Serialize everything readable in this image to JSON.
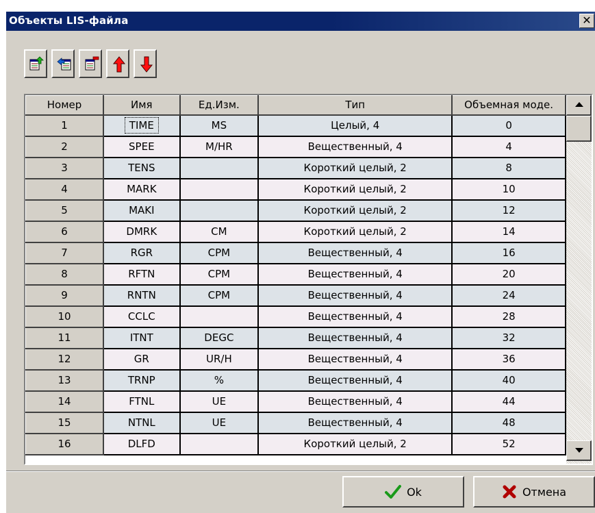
{
  "window": {
    "title": "Объекты LIS-файла",
    "close_glyph": "✕"
  },
  "toolbar": {
    "buttons": [
      {
        "name": "add-object-icon"
      },
      {
        "name": "copy-object-icon"
      },
      {
        "name": "delete-object-icon"
      },
      {
        "name": "move-up-arrow-icon"
      },
      {
        "name": "move-down-arrow-icon"
      }
    ]
  },
  "table": {
    "columns": [
      "Номер",
      "Имя",
      "Ед.Изм.",
      "Тип",
      "Объемная моде."
    ],
    "rows": [
      [
        "1",
        "TIME",
        "MS",
        "Целый, 4",
        "0"
      ],
      [
        "2",
        "SPEE",
        "M/HR",
        "Вещественный, 4",
        "4"
      ],
      [
        "3",
        "TENS",
        "",
        "Короткий целый, 2",
        "8"
      ],
      [
        "4",
        "MARK",
        "",
        "Короткий целый, 2",
        "10"
      ],
      [
        "5",
        "MAKI",
        "",
        "Короткий целый, 2",
        "12"
      ],
      [
        "6",
        "DMRK",
        "CM",
        "Короткий целый, 2",
        "14"
      ],
      [
        "7",
        "RGR",
        "CPM",
        "Вещественный, 4",
        "16"
      ],
      [
        "8",
        "RFTN",
        "CPM",
        "Вещественный, 4",
        "20"
      ],
      [
        "9",
        "RNTN",
        "CPM",
        "Вещественный, 4",
        "24"
      ],
      [
        "10",
        "CCLC",
        "",
        "Вещественный, 4",
        "28"
      ],
      [
        "11",
        "ITNT",
        "DEGC",
        "Вещественный, 4",
        "32"
      ],
      [
        "12",
        "GR",
        "UR/H",
        "Вещественный, 4",
        "36"
      ],
      [
        "13",
        "TRNP",
        "%",
        "Вещественный, 4",
        "40"
      ],
      [
        "14",
        "FTNL",
        "UE",
        "Вещественный, 4",
        "44"
      ],
      [
        "15",
        "NTNL",
        "UE",
        "Вещественный, 4",
        "48"
      ],
      [
        "16",
        "DLFD",
        "",
        "Короткий целый, 2",
        "52"
      ]
    ]
  },
  "buttons": {
    "ok_label": "Ok",
    "cancel_label": "Отмена"
  },
  "colors": {
    "titlebar": "#0a246a",
    "row_odd": "#dde3e8",
    "row_even": "#f3edf2",
    "ok_check": "#1a9a1a",
    "cancel_x": "#b00000"
  }
}
